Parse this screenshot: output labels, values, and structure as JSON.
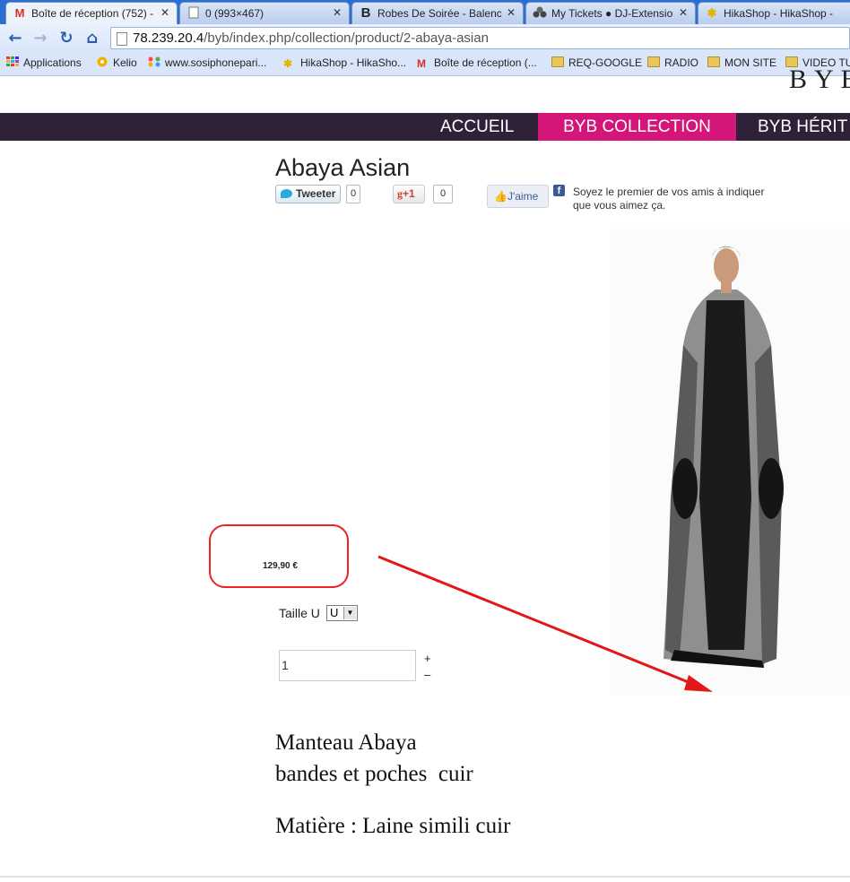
{
  "browser": {
    "tabs": [
      {
        "title": "Boîte de réception (752) -",
        "icon": "gmail-icon"
      },
      {
        "title": "0 (993×467)",
        "icon": "page-icon"
      },
      {
        "title": "Robes De Soirée - Balencia",
        "icon": "b-icon"
      },
      {
        "title": "My Tickets ● DJ-Extension",
        "icon": "ticket-icon"
      },
      {
        "title": "HikaShop - HikaShop - Re",
        "icon": "hikashop-icon"
      }
    ],
    "url_host": "78.239.20.4",
    "url_path": "/byb/index.php/collection/product/2-abaya-asian",
    "bookmarks": [
      {
        "label": "Applications",
        "icon": "apps-icon"
      },
      {
        "label": "Kelio",
        "icon": "kelio-icon"
      },
      {
        "label": "www.sosiphonepari...",
        "icon": "joomla-icon"
      },
      {
        "label": "HikaShop - HikaSho...",
        "icon": "hikashop-icon"
      },
      {
        "label": "Boîte de réception (...",
        "icon": "gmail-icon"
      },
      {
        "label": "REQ-GOOGLE",
        "icon": "folder-icon"
      },
      {
        "label": "RADIO",
        "icon": "folder-icon"
      },
      {
        "label": "MON SITE",
        "icon": "folder-icon"
      },
      {
        "label": "VIDEO TU",
        "icon": "folder-icon"
      }
    ]
  },
  "site": {
    "brand_fragment": "BYB",
    "nav": [
      {
        "label": "ACCUEIL"
      },
      {
        "label": "BYB COLLECTION",
        "active": true
      },
      {
        "label": "BYB HÉRIT"
      }
    ],
    "accent_color": "#d4167a",
    "nav_bg_color": "#2f2238"
  },
  "product": {
    "title": "Abaya Asian",
    "social": {
      "tweet_label": "Tweeter",
      "tweet_count": "0",
      "gplus_label": "+1",
      "gplus_count": "0",
      "fb_like_label": "J'aime",
      "fb_text": "Soyez le premier de vos amis à indiquer que vous aimez ça."
    },
    "price": "129,90 €",
    "size_label": "Taille U",
    "size_value": "U",
    "quantity": "1",
    "qty_plus": "+",
    "qty_minus": "–",
    "description": [
      "Manteau Abaya",
      "bandes et poches  cuir",
      "Matière : Laine simili cuir"
    ]
  },
  "annotation": {
    "color": "#e01818"
  }
}
